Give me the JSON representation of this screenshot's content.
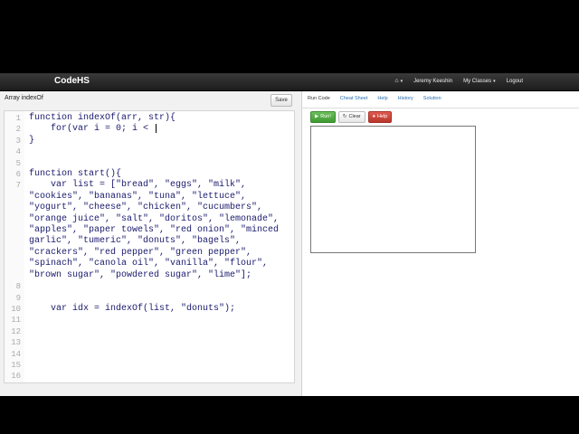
{
  "navbar": {
    "brand": "CodeHS",
    "home_icon": "home-icon",
    "user": "Jeremy Keeshin",
    "classes": "My Classes",
    "logout": "Logout"
  },
  "assignment": {
    "title": "Array indexOf",
    "save_label": "Save"
  },
  "editor": {
    "lines": [
      {
        "n": "1",
        "code": "function indexOf(arr, str){"
      },
      {
        "n": "2",
        "code": "    for(var i = 0; i < ",
        "cursor": true
      },
      {
        "n": "3",
        "code": "}"
      },
      {
        "n": "4",
        "code": ""
      },
      {
        "n": "5",
        "code": ""
      },
      {
        "n": "6",
        "code": "function start(){"
      },
      {
        "n": "7",
        "code": "    var list = [\"bread\", \"eggs\", \"milk\","
      },
      {
        "n": "",
        "code": "\"cookies\", \"bananas\", \"tuna\", \"lettuce\","
      },
      {
        "n": "",
        "code": "\"yogurt\", \"cheese\", \"chicken\", \"cucumbers\","
      },
      {
        "n": "",
        "code": "\"orange juice\", \"salt\", \"doritos\", \"lemonade\","
      },
      {
        "n": "",
        "code": "\"apples\", \"paper towels\", \"red onion\", \"minced"
      },
      {
        "n": "",
        "code": "garlic\", \"tumeric\", \"donuts\", \"bagels\","
      },
      {
        "n": "",
        "code": "\"crackers\", \"red pepper\", \"green pepper\","
      },
      {
        "n": "",
        "code": "\"spinach\", \"canola oil\", \"vanilla\", \"flour\","
      },
      {
        "n": "",
        "code": "\"brown sugar\", \"powdered sugar\", \"lime\"];"
      },
      {
        "n": "8",
        "code": ""
      },
      {
        "n": "9",
        "code": ""
      },
      {
        "n": "10",
        "code": "    var idx = indexOf(list, \"donuts\");"
      },
      {
        "n": "11",
        "code": ""
      },
      {
        "n": "12",
        "code": ""
      },
      {
        "n": "13",
        "code": ""
      },
      {
        "n": "14",
        "code": ""
      },
      {
        "n": "15",
        "code": ""
      },
      {
        "n": "16",
        "code": ""
      }
    ]
  },
  "tabs": [
    {
      "label": "Run Code",
      "active": true
    },
    {
      "label": "Cheat Sheet",
      "active": false
    },
    {
      "label": "Help",
      "active": false
    },
    {
      "label": "History",
      "active": false
    },
    {
      "label": "Solution",
      "active": false
    }
  ],
  "controls": {
    "run": "Run!",
    "clear": "Clear",
    "help": "Help"
  },
  "colors": {
    "run": "#4caf3f",
    "help": "#c9443a",
    "link": "#2a6fb3"
  }
}
